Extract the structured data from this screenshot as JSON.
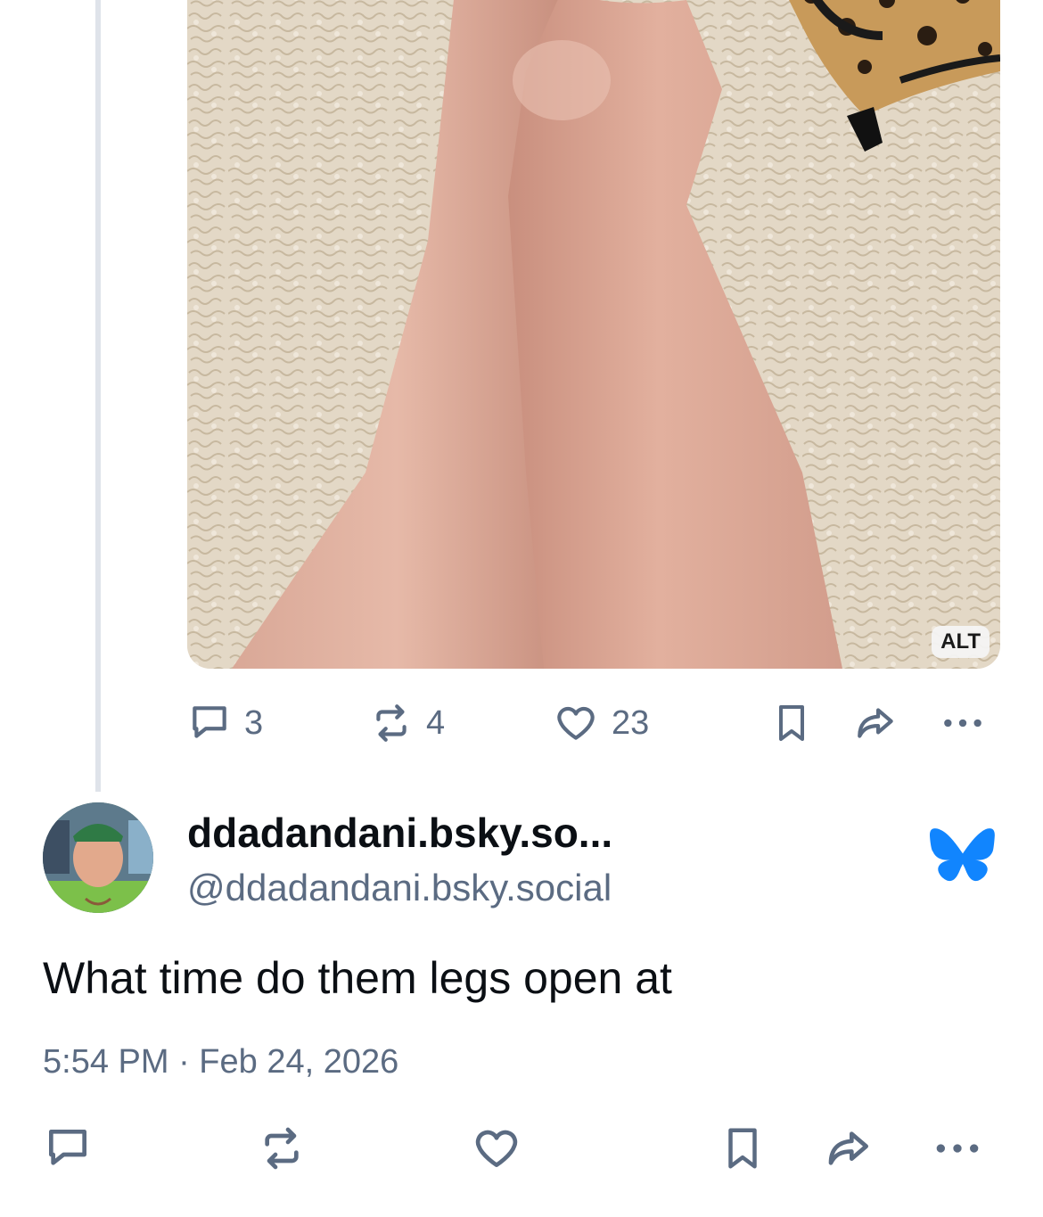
{
  "image": {
    "alt_label": "ALT"
  },
  "parent_post": {
    "replies": "3",
    "reposts": "4",
    "likes": "23"
  },
  "post": {
    "display_name": "ddadandani.bsky.so...",
    "handle": "@ddadandani.bsky.social",
    "text": "What time do them legs open at",
    "timestamp": "5:54 PM · Feb 24, 2026"
  },
  "icons": {
    "reply": "reply-icon",
    "repost": "repost-icon",
    "like": "heart-icon",
    "bookmark": "bookmark-icon",
    "share": "share-icon",
    "more": "more-icon",
    "app": "butterfly-icon"
  },
  "colors": {
    "icon_gray": "#5b6b82",
    "bluesky_blue": "#1185fe",
    "thread_line": "#dfe3ea"
  }
}
